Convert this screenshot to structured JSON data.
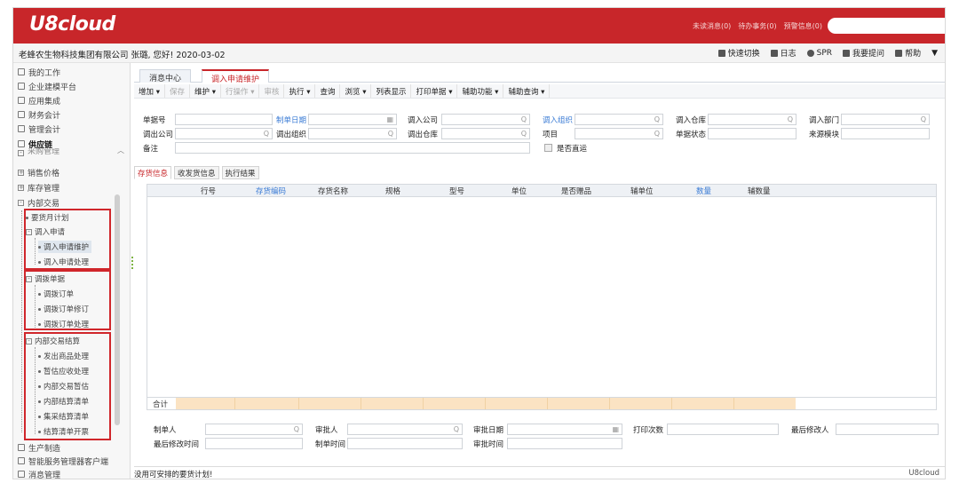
{
  "app": {
    "logo": "U8cloud",
    "top_links": [
      "未读消息(0)",
      "待办事务(0)",
      "预警信息(0)"
    ]
  },
  "subbar": {
    "company_user_date": "老蜂农生物科技集团有限公司 张璐, 您好! 2020-03-02",
    "tools": [
      "快速切换",
      "日志",
      "SPR",
      "我要提问",
      "帮助"
    ]
  },
  "sidebar": {
    "top_items": [
      "我的工作",
      "企业建模平台",
      "应用集成",
      "财务会计",
      "管理会计"
    ],
    "group": "供应链",
    "partial": "采购管理",
    "items": [
      "销售价格",
      "库存管理"
    ],
    "internal_trade": "内部交易",
    "tree": {
      "plan": "要货月计划",
      "transfer_request": "调入申请",
      "transfer_request_children": [
        "调入申请维护",
        "调入申请处理"
      ],
      "allocation": "调拨单据",
      "allocation_children": [
        "调拨订单",
        "调拨订单修订",
        "调拨订单处理"
      ],
      "settlement": "内部交易结算",
      "settlement_children": [
        "发出商品处理",
        "暂估应收处理",
        "内部交易暂估",
        "内部结算清单",
        "集采结算清单",
        "结算清单开票"
      ]
    },
    "bottom_items": [
      "生产制造",
      "智能服务管理器客户端",
      "消息管理"
    ]
  },
  "tabs": [
    "消息中心",
    "调入申请维护"
  ],
  "toolbar": [
    "增加",
    "保存",
    "维护",
    "行操作",
    "审核",
    "执行",
    "查询",
    "浏览",
    "列表显示",
    "打印单据",
    "辅助功能",
    "辅助查询"
  ],
  "form": {
    "doc_no": "单据号",
    "create_date": "制单日期",
    "in_company": "调入公司",
    "in_org": "调入组织",
    "in_warehouse": "调入仓库",
    "in_dept": "调入部门",
    "out_company": "调出公司",
    "out_org": "调出组织",
    "out_warehouse": "调出仓库",
    "project": "项目",
    "doc_status": "单据状态",
    "source_module": "来源模块",
    "remark": "备注",
    "direct_ship": "是否直运"
  },
  "subtabs": [
    "存货信息",
    "收发货信息",
    "执行结果"
  ],
  "grid": {
    "columns": [
      "行号",
      "存货编码",
      "存货名称",
      "规格",
      "型号",
      "单位",
      "是否赠品",
      "辅单位",
      "数量",
      "辅数量"
    ],
    "total_label": "合计"
  },
  "footer": {
    "creator": "制单人",
    "approver": "审批人",
    "approve_date": "审批日期",
    "print_count": "打印次数",
    "last_modifier": "最后修改人",
    "last_modify_time": "最后修改时间",
    "create_time": "制单时间",
    "approve_time": "审批时间"
  },
  "status": {
    "message": "没用可安排的要货计划!",
    "brand": "U8cloud"
  },
  "colors": {
    "brand_red": "#c8262a",
    "link_blue": "#3a7bd5",
    "highlight_box": "#d0262b"
  }
}
